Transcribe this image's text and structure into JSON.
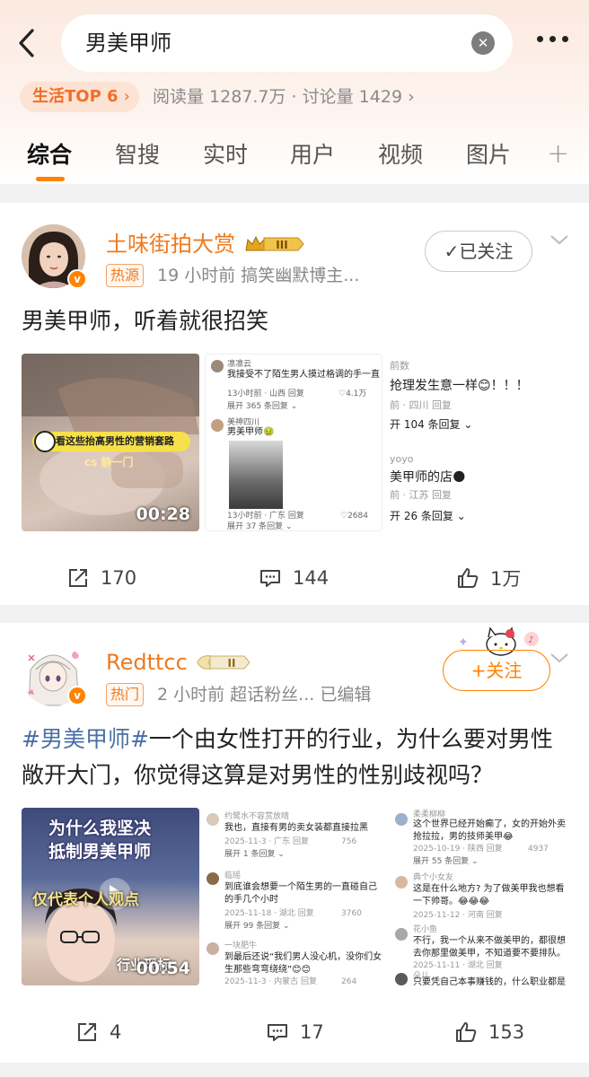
{
  "search": {
    "query": "男美甲师"
  },
  "topic": {
    "badge": "生活TOP 6",
    "stats": "阅读量 1287.7万 · 讨论量 1429 ›"
  },
  "tabs": [
    "综合",
    "智搜",
    "实时",
    "用户",
    "视频",
    "图片"
  ],
  "posts": [
    {
      "username": "土味街拍大赏",
      "level": "III",
      "tag": "热源",
      "meta": "19 小时前  搞笑幽默博主...",
      "follow_label": "已关注",
      "text": "男美甲师，听着就很招笑",
      "video": {
        "caption": "看这些抬高男性的营销套路",
        "watermark": "cs 静一门",
        "duration": "00:28"
      },
      "screenshot_a": {
        "user1": "凛凛云",
        "comment1": "我接受不了陌生男人摸过格调的手一直拿着我的手",
        "meta1": "13小时前 · 山西   回复",
        "likes1": "♡4.1万",
        "expand1": "展开 365 条回复 ⌄",
        "user2": "美神四川",
        "comment2": "男美甲师🤢",
        "meta2": "13小时前 · 广东   回复",
        "likes2": "♡2684",
        "expand2": "展开 37 条回复 ⌄"
      },
      "screenshot_b": {
        "user1": "前数",
        "comment1": "抢理发生意一样😊！！！",
        "meta1": "前 · 四川     回复",
        "expand1": "开 104 条回复 ⌄",
        "user2": "yoyo",
        "comment2": "美甲师的店🌑",
        "meta2": "前 · 江苏     回复",
        "expand2": "开 26 条回复 ⌄"
      },
      "actions": {
        "share": "170",
        "comment": "144",
        "like": "1万"
      }
    },
    {
      "username": "Redttcc",
      "level": "II",
      "tag": "热门",
      "meta": "2 小时前  超话粉丝...  已编辑",
      "follow_label": "+关注",
      "text_hashtag": "#男美甲师#",
      "text_rest": "一个由女性打开的行业，为什么要对男性敞开大门，你觉得这算是对男性的性别歧视吗？",
      "video": {
        "caption_line1": "为什么我坚决",
        "caption_line2": "抵制男美甲师",
        "caption_line3": "仅代表个人观点",
        "caption_line4": "行业现标",
        "duration": "00:54"
      },
      "screenshot_a": {
        "c1_user": "约鹭水不容赏放晴",
        "c1_text": "我也，直接有男的卖女装都直接拉黑",
        "c1_meta": "2025-11-3 · 广东   回复",
        "c1_likes": "756",
        "c1_expand": "展开 1 条回复 ⌄",
        "c2_user": "临瑶",
        "c2_text": "到底谁会想要一个陌生男的一直碰自己的手几个小时",
        "c2_meta": "2025-11-18 · 湖北   回复",
        "c2_likes": "3760",
        "c2_expand": "展开 99 条回复 ⌄",
        "c3_user": "一块肥牛",
        "c3_text": "到最后还说“我们男人没心机，没你们女生那些弯弯绕绕”😊😊",
        "c3_meta": "2025-11-3 · 内蒙古   回复",
        "c3_likes": "264"
      },
      "screenshot_b": {
        "c1_user": "柔柔柳柳",
        "c1_text": "这个世界已经开始癫了，女的开始外卖抢拉拉，男的技师美甲😂",
        "c1_meta": "2025-10-19 · 陕西   回复",
        "c1_likes": "4937",
        "c1_expand": "展开 55 条回复 ⌄",
        "c2_user": "典个小女友",
        "c2_text": "这是在什么地方? 为了做美甲我也想看一下帅哥。😂😂😂",
        "c2_meta": "2025-11-12 · 河南   回复",
        "c3_user": "花小鱼",
        "c3_text": "不行，我一个从来不做美甲的，都很想去你那里做美甲，不知道要不要排队。",
        "c3_meta": "2025-11-11 · 湖北   回复",
        "c4_user": "朵儿",
        "c4_text": "只要凭自己本事赚钱的，什么职业都是值得我们的"
      },
      "actions": {
        "share": "4",
        "comment": "17",
        "like": "153"
      }
    }
  ],
  "colors": {
    "accent": "#ff8200",
    "username": "#ee7a1f",
    "hashtag": "#4a6fa5"
  }
}
